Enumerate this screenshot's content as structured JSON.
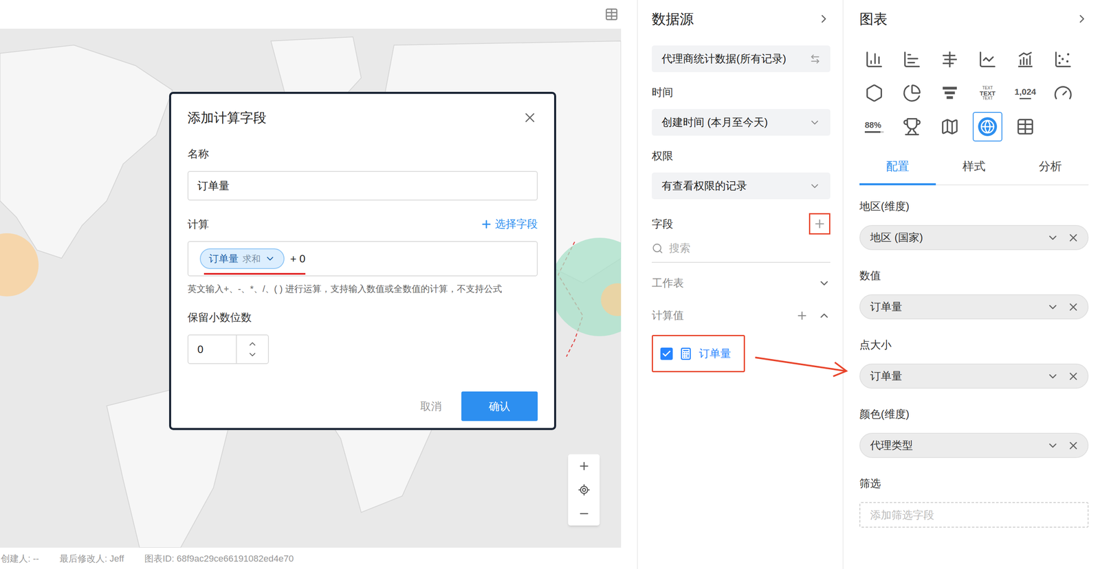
{
  "map": {
    "bubbles": [
      {
        "color": "#f9cf95"
      },
      {
        "color": "#a8e0c8"
      },
      {
        "color": "#f9cf95"
      }
    ]
  },
  "dialog": {
    "title": "添加计算字段",
    "name_label": "名称",
    "name_value": "订单量",
    "calc_label": "计算",
    "pick_field": "选择字段",
    "chip": {
      "field": "订单量",
      "aggregation": "求和",
      "underlined": true
    },
    "expression": "+ 0",
    "hint": "英文输入+、-、*、/、( ) 进行运算，支持输入数值或全数值的计算，不支持公式",
    "decimals_label": "保留小数位数",
    "decimals_value": "0",
    "buttons": [
      "取消",
      "确认"
    ]
  },
  "data_source": {
    "title": "数据源",
    "source": "代理商统计数据(所有记录)",
    "sections": [
      {
        "label": "时间",
        "value": "创建时间 (本月至今天)"
      },
      {
        "label": "权限",
        "value": "有查看权限的记录"
      }
    ],
    "fields_label": "字段",
    "add_field_highlighted": true,
    "search_placeholder": "搜索",
    "groups": [
      {
        "label": "工作表",
        "expanded": false,
        "addable": false,
        "items": []
      },
      {
        "label": "计算值",
        "expanded": true,
        "addable": true,
        "items": [
          {
            "label": "订单量",
            "checked": true,
            "highlighted": true
          }
        ]
      }
    ]
  },
  "chart_panel": {
    "title": "图表",
    "chart_types": [
      {
        "kind": "column",
        "selected": false
      },
      {
        "kind": "bar",
        "selected": false
      },
      {
        "kind": "bullet",
        "selected": false
      },
      {
        "kind": "line",
        "selected": false
      },
      {
        "kind": "combo",
        "selected": false
      },
      {
        "kind": "scatter",
        "selected": false
      },
      {
        "kind": "radar",
        "selected": false
      },
      {
        "kind": "pie",
        "selected": false
      },
      {
        "kind": "funnel",
        "selected": false
      },
      {
        "kind": "wordcloud",
        "selected": false,
        "lines": [
          "TEXT",
          "TEXT",
          "TEXT"
        ]
      },
      {
        "kind": "number",
        "selected": false,
        "label": "1,024"
      },
      {
        "kind": "gauge",
        "selected": false
      },
      {
        "kind": "progress",
        "selected": false,
        "label": "88%"
      },
      {
        "kind": "trophy",
        "selected": false
      },
      {
        "kind": "map",
        "selected": false
      },
      {
        "kind": "globe",
        "selected": true
      },
      {
        "kind": "table",
        "selected": false
      }
    ],
    "tabs": [
      {
        "label": "配置",
        "selected": true
      },
      {
        "label": "样式",
        "selected": false
      },
      {
        "label": "分析",
        "selected": false
      }
    ],
    "slots": [
      {
        "label": "地区(维度)",
        "value": "地区 (国家)"
      },
      {
        "label": "数值",
        "value": "订单量"
      },
      {
        "label": "点大小",
        "value": "订单量"
      },
      {
        "label": "颜色(维度)",
        "value": "代理类型"
      }
    ],
    "filter": {
      "label": "筛选",
      "placeholder": "添加筛选字段"
    }
  },
  "annotations": {
    "arrow_to_point_size": true
  },
  "footer": {
    "creator": "创建人: --",
    "modifier": "最后修改人: Jeff",
    "chart_id": "图表ID: 68f9ac29ce66191082ed4e70"
  }
}
